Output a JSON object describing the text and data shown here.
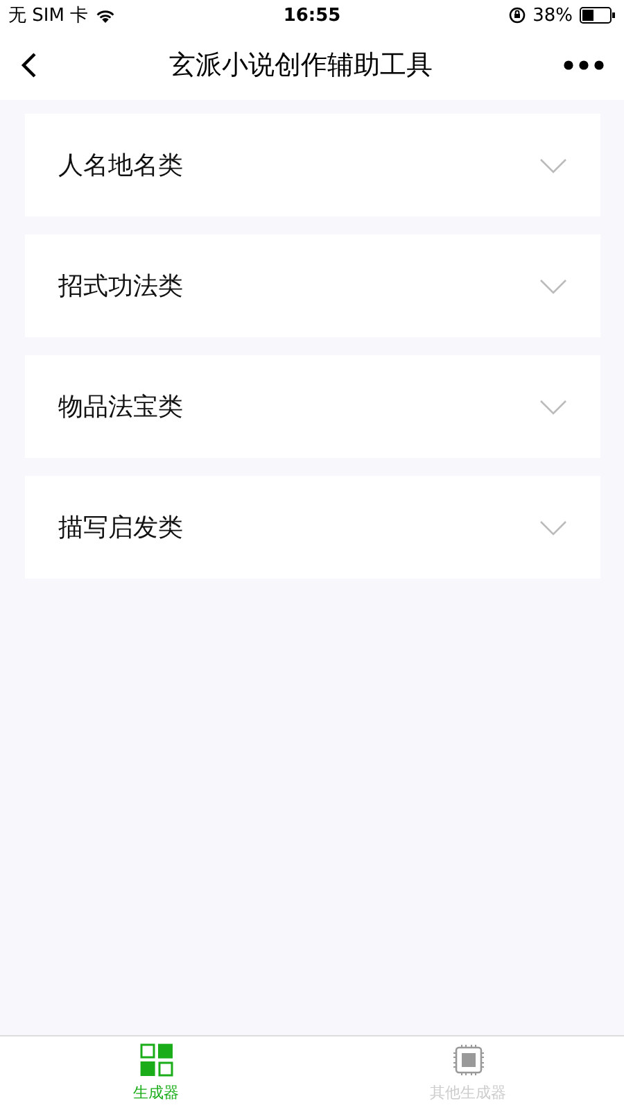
{
  "status_bar": {
    "carrier": "无 SIM 卡",
    "time": "16:55",
    "battery": "38%"
  },
  "nav_bar": {
    "title": "玄派小说创作辅助工具"
  },
  "sections": [
    {
      "label": "人名地名类",
      "expanded": false
    },
    {
      "label": "招式功法类",
      "expanded": false
    },
    {
      "label": "物品法宝类",
      "expanded": false
    },
    {
      "label": "描写启发类",
      "expanded": false
    }
  ],
  "tabs": [
    {
      "label": "生成器",
      "kind": "grid",
      "selected": true
    },
    {
      "label": "其他生成器",
      "kind": "chip",
      "selected": false
    }
  ]
}
